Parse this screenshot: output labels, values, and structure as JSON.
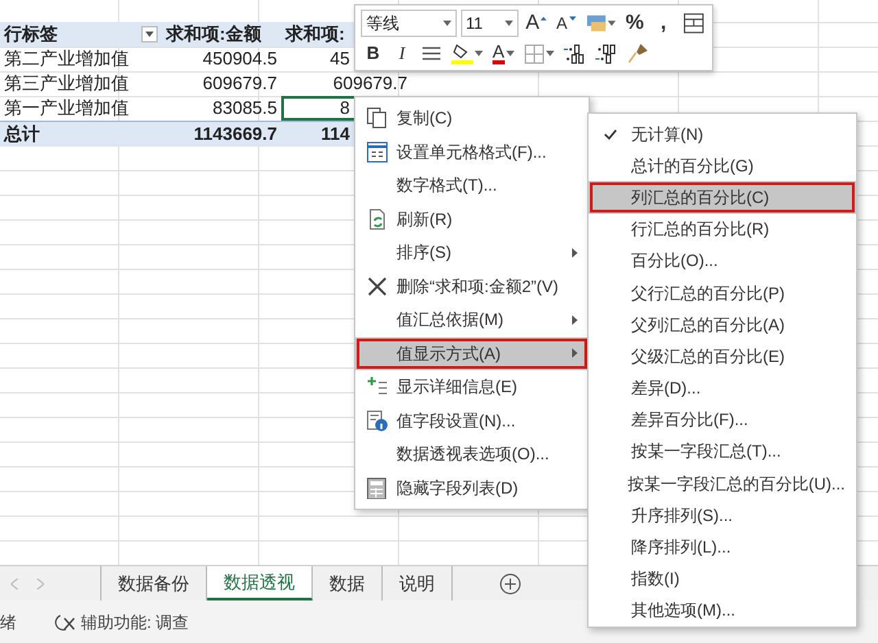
{
  "pivot_table": {
    "header": [
      "行标签",
      "求和项:金额",
      "求和项:"
    ],
    "rows": [
      {
        "cells": [
          {
            "text": "第二产业增加值",
            "selected": false
          },
          {
            "text": "450904.5",
            "selected": false
          },
          {
            "text": "45",
            "selected": false
          }
        ]
      },
      {
        "cells": [
          {
            "text": "第三产业增加值",
            "selected": false
          },
          {
            "text": "609679.7",
            "selected": false
          },
          {
            "text": "609679.7",
            "selected": false
          }
        ]
      },
      {
        "cells": [
          {
            "text": "第一产业增加值",
            "selected": false
          },
          {
            "text": "83085.5",
            "selected": false
          },
          {
            "text": "8",
            "selected": true
          }
        ]
      }
    ],
    "total": [
      "总计",
      "1143669.7",
      "114"
    ]
  },
  "mini_toolbar": {
    "font": "等线",
    "size": "11",
    "row_1": [
      {
        "kind": "grow-font",
        "label": "A"
      },
      {
        "kind": "shrink-font",
        "label": "A"
      },
      {
        "kind": "accounting"
      },
      {
        "kind": "percent",
        "label": "%"
      },
      {
        "kind": "comma",
        "label": ","
      },
      {
        "kind": "table-format"
      }
    ],
    "row_2": [
      {
        "kind": "bold",
        "label": "B"
      },
      {
        "kind": "italic",
        "label": "I"
      },
      {
        "kind": "align"
      },
      {
        "kind": "fill-color"
      },
      {
        "kind": "font-color",
        "label": "A"
      },
      {
        "kind": "borders"
      },
      {
        "kind": "increase-decimal"
      },
      {
        "kind": "decrease-decimal"
      },
      {
        "kind": "format-painter"
      }
    ]
  },
  "context_menu": {
    "items": [
      {
        "label": "复制(C)",
        "submenu": false,
        "selected": false
      },
      {
        "label": "设置单元格格式(F)...",
        "submenu": false,
        "selected": false
      },
      {
        "label": "数字格式(T)...",
        "submenu": false,
        "selected": false
      },
      {
        "label": "刷新(R)",
        "submenu": false,
        "selected": false
      },
      {
        "label": "排序(S)",
        "submenu": true,
        "selected": false
      },
      {
        "label": "删除“求和项:金额2”(V)",
        "submenu": false,
        "selected": false
      },
      {
        "label": "值汇总依据(M)",
        "submenu": true,
        "selected": false
      },
      {
        "label": "值显示方式(A)",
        "submenu": true,
        "selected": true
      },
      {
        "label": "显示详细信息(E)",
        "submenu": false,
        "selected": false
      },
      {
        "label": "值字段设置(N)...",
        "submenu": false,
        "selected": false
      },
      {
        "label": "数据透视表选项(O)...",
        "submenu": false,
        "selected": false
      },
      {
        "label": "隐藏字段列表(D)",
        "submenu": false,
        "selected": false
      }
    ]
  },
  "submenu": {
    "items": [
      {
        "label": "无计算(N)",
        "checked": true,
        "selected": false
      },
      {
        "label": "总计的百分比(G)",
        "checked": false,
        "selected": false
      },
      {
        "label": "列汇总的百分比(C)",
        "checked": false,
        "selected": true
      },
      {
        "label": "行汇总的百分比(R)",
        "checked": false,
        "selected": false
      },
      {
        "label": "百分比(O)...",
        "checked": false,
        "selected": false
      },
      {
        "label": "父行汇总的百分比(P)",
        "checked": false,
        "selected": false
      },
      {
        "label": "父列汇总的百分比(A)",
        "checked": false,
        "selected": false
      },
      {
        "label": "父级汇总的百分比(E)",
        "checked": false,
        "selected": false
      },
      {
        "label": "差异(D)...",
        "checked": false,
        "selected": false
      },
      {
        "label": "差异百分比(F)...",
        "checked": false,
        "selected": false
      },
      {
        "label": "按某一字段汇总(T)...",
        "checked": false,
        "selected": false
      },
      {
        "label": "按某一字段汇总的百分比(U)...",
        "checked": false,
        "selected": false
      },
      {
        "label": "升序排列(S)...",
        "checked": false,
        "selected": false
      },
      {
        "label": "降序排列(L)...",
        "checked": false,
        "selected": false
      },
      {
        "label": "指数(I)",
        "checked": false,
        "selected": false
      },
      {
        "label": "其他选项(M)...",
        "checked": false,
        "selected": false
      }
    ]
  },
  "sheet_tabs": [
    {
      "label": "数据备份",
      "selected": false
    },
    {
      "label": "数据透视",
      "selected": true
    },
    {
      "label": "数据",
      "selected": false
    },
    {
      "label": "说明",
      "selected": false
    }
  ],
  "status_bar": {
    "mode": "绪",
    "accessibility": "辅助功能: 调查"
  }
}
